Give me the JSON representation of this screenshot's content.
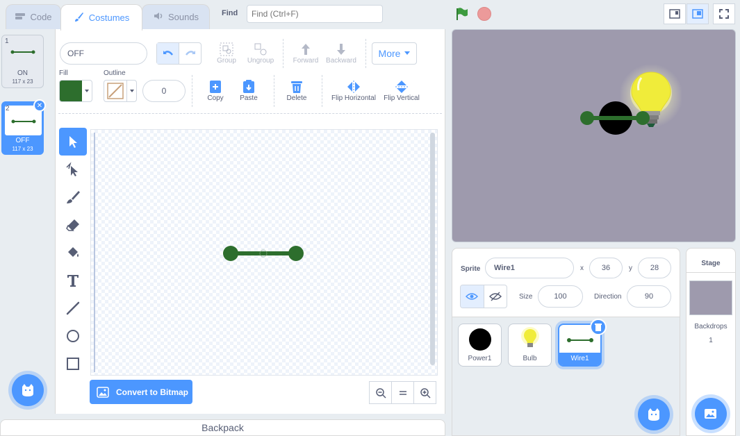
{
  "tabs": {
    "code": "Code",
    "costumes": "Costumes",
    "sounds": "Sounds"
  },
  "find": {
    "label": "Find",
    "placeholder": "Find (Ctrl+F)"
  },
  "costumes": [
    {
      "num": "1",
      "name": "ON",
      "size": "117 x 23"
    },
    {
      "num": "2",
      "name": "OFF",
      "size": "117 x 23"
    }
  ],
  "editor": {
    "costume_name": "OFF",
    "toolbar": {
      "group": "Group",
      "ungroup": "Ungroup",
      "forward": "Forward",
      "backward": "Backward",
      "more": "More"
    },
    "fill_label": "Fill",
    "outline_label": "Outline",
    "outline_width": "0",
    "actions": {
      "copy": "Copy",
      "paste": "Paste",
      "delete": "Delete",
      "flip_h": "Flip Horizontal",
      "flip_v": "Flip Vertical"
    },
    "convert_label": "Convert to Bitmap",
    "fill_color": "#2d6e2d"
  },
  "backpack": "Backpack",
  "sprite_info": {
    "sprite_label": "Sprite",
    "sprite_name": "Wire1",
    "x_label": "x",
    "x": "36",
    "y_label": "y",
    "y": "28",
    "size_label": "Size",
    "size": "100",
    "direction_label": "Direction",
    "direction": "90"
  },
  "sprites": [
    {
      "name": "Power1"
    },
    {
      "name": "Bulb"
    },
    {
      "name": "Wire1"
    }
  ],
  "stage_panel": {
    "title": "Stage",
    "backdrops_label": "Backdrops",
    "backdrops_count": "1"
  },
  "colors": {
    "accent": "#4c97ff",
    "wire": "#2d6e2d",
    "stage_bg": "#9e9aad"
  }
}
